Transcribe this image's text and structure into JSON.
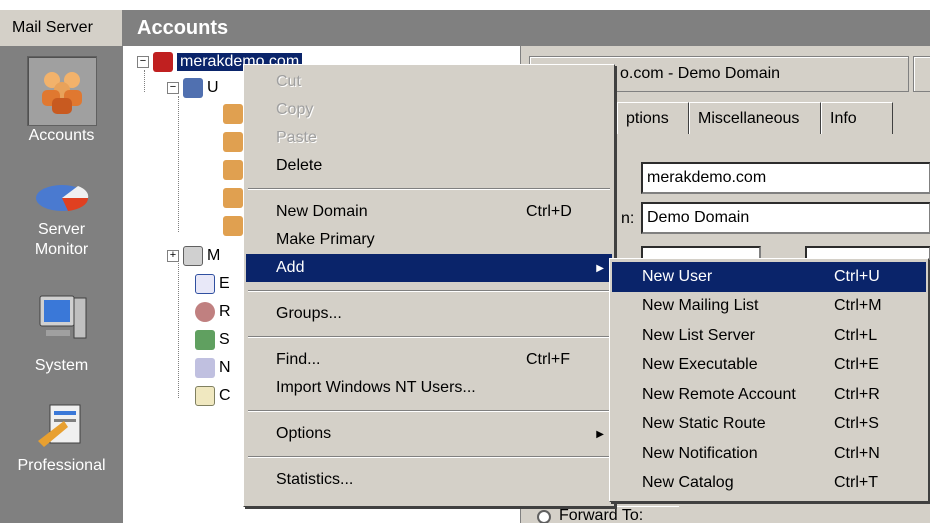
{
  "sidebar": {
    "header": "Mail Server",
    "items": [
      {
        "label": "Accounts",
        "icon": "accounts-icon"
      },
      {
        "label": "Server Monitor",
        "icon": "server-monitor-icon"
      },
      {
        "label": "System",
        "icon": "system-icon"
      },
      {
        "label": "Professional",
        "icon": "professional-icon"
      }
    ]
  },
  "title": "Accounts",
  "tree": {
    "domain": "merakdemo.com",
    "users_letter": "U",
    "nodes": [
      "M",
      "E",
      "R",
      "S",
      "N",
      "C"
    ]
  },
  "right_panel": {
    "domain_title": "o.com - Demo Domain",
    "tabs": [
      "ptions",
      "Miscellaneous",
      "Info"
    ],
    "domain_field": "merakdemo.com",
    "description_label": "n:",
    "description_field": "Demo Domain",
    "forward_label": "Forward To:"
  },
  "context_menu": {
    "items": [
      {
        "label": "Cut",
        "shortcut": "",
        "disabled": true
      },
      {
        "label": "Copy",
        "shortcut": "",
        "disabled": true
      },
      {
        "label": "Paste",
        "shortcut": "",
        "disabled": true
      },
      {
        "label": "Delete",
        "shortcut": ""
      },
      {
        "label": "New Domain",
        "shortcut": "Ctrl+D"
      },
      {
        "label": "Make Primary",
        "shortcut": ""
      },
      {
        "label": "Add",
        "shortcut": "",
        "submenu": true,
        "highlighted": true
      },
      {
        "label": "Groups...",
        "shortcut": ""
      },
      {
        "label": "Find...",
        "shortcut": "Ctrl+F"
      },
      {
        "label": "Import Windows NT Users...",
        "shortcut": ""
      },
      {
        "label": "Options",
        "shortcut": "",
        "submenu": true
      },
      {
        "label": "Statistics...",
        "shortcut": ""
      }
    ]
  },
  "submenu": {
    "items": [
      {
        "label": "New User",
        "shortcut": "Ctrl+U",
        "highlighted": true
      },
      {
        "label": "New Mailing List",
        "shortcut": "Ctrl+M"
      },
      {
        "label": "New List Server",
        "shortcut": "Ctrl+L"
      },
      {
        "label": "New Executable",
        "shortcut": "Ctrl+E"
      },
      {
        "label": "New Remote Account",
        "shortcut": "Ctrl+R"
      },
      {
        "label": "New Static Route",
        "shortcut": "Ctrl+S"
      },
      {
        "label": "New Notification",
        "shortcut": "Ctrl+N"
      },
      {
        "label": "New Catalog",
        "shortcut": "Ctrl+T"
      }
    ]
  },
  "colors": {
    "highlight": "#0a246a",
    "panel": "#d4d0c8",
    "sidebar": "#808080"
  }
}
